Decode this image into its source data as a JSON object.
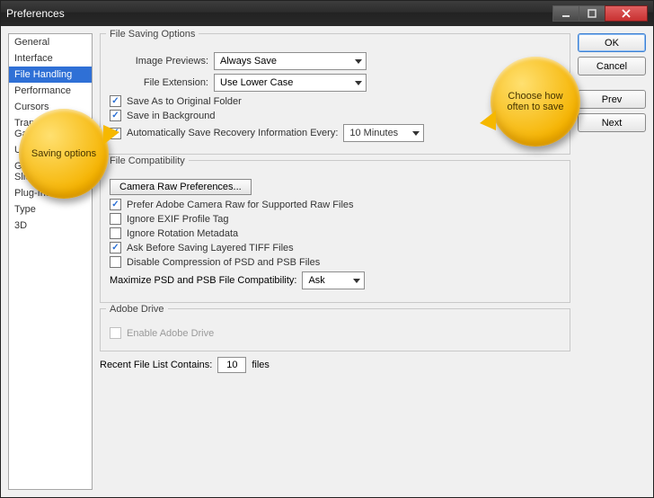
{
  "window": {
    "title": "Preferences"
  },
  "sidebar": {
    "items": [
      {
        "label": "General"
      },
      {
        "label": "Interface"
      },
      {
        "label": "File Handling",
        "selected": true
      },
      {
        "label": "Performance"
      },
      {
        "label": "Cursors"
      },
      {
        "label": "Transparency & Gamut"
      },
      {
        "label": "Units & Rulers"
      },
      {
        "label": "Guides, Grid & Slices"
      },
      {
        "label": "Plug-Ins"
      },
      {
        "label": "Type"
      },
      {
        "label": "3D"
      }
    ]
  },
  "buttons": {
    "ok": "OK",
    "cancel": "Cancel",
    "prev": "Prev",
    "next": "Next"
  },
  "fileSaving": {
    "legend": "File Saving Options",
    "imagePreviewsLabel": "Image Previews:",
    "imagePreviewsValue": "Always Save",
    "fileExtLabel": "File Extension:",
    "fileExtValue": "Use Lower Case",
    "saveOriginal": "Save As to Original Folder",
    "saveBg": "Save in Background",
    "autoSave": "Automatically Save Recovery Information Every:",
    "autoSaveInterval": "10 Minutes"
  },
  "fileCompat": {
    "legend": "File Compatibility",
    "cameraRawBtn": "Camera Raw Preferences...",
    "preferRaw": "Prefer Adobe Camera Raw for Supported Raw Files",
    "ignoreExif": "Ignore EXIF Profile Tag",
    "ignoreRot": "Ignore Rotation Metadata",
    "askTiff": "Ask Before Saving Layered TIFF Files",
    "disablePsd": "Disable Compression of PSD and PSB Files",
    "maxLabel": "Maximize PSD and PSB File Compatibility:",
    "maxValue": "Ask"
  },
  "adobeDrive": {
    "legend": "Adobe Drive",
    "enable": "Enable Adobe Drive"
  },
  "recent": {
    "label1": "Recent File List Contains:",
    "value": "10",
    "label2": "files"
  },
  "callouts": {
    "savingOptions": "Saving options",
    "chooseInterval": "Choose how often to save"
  }
}
